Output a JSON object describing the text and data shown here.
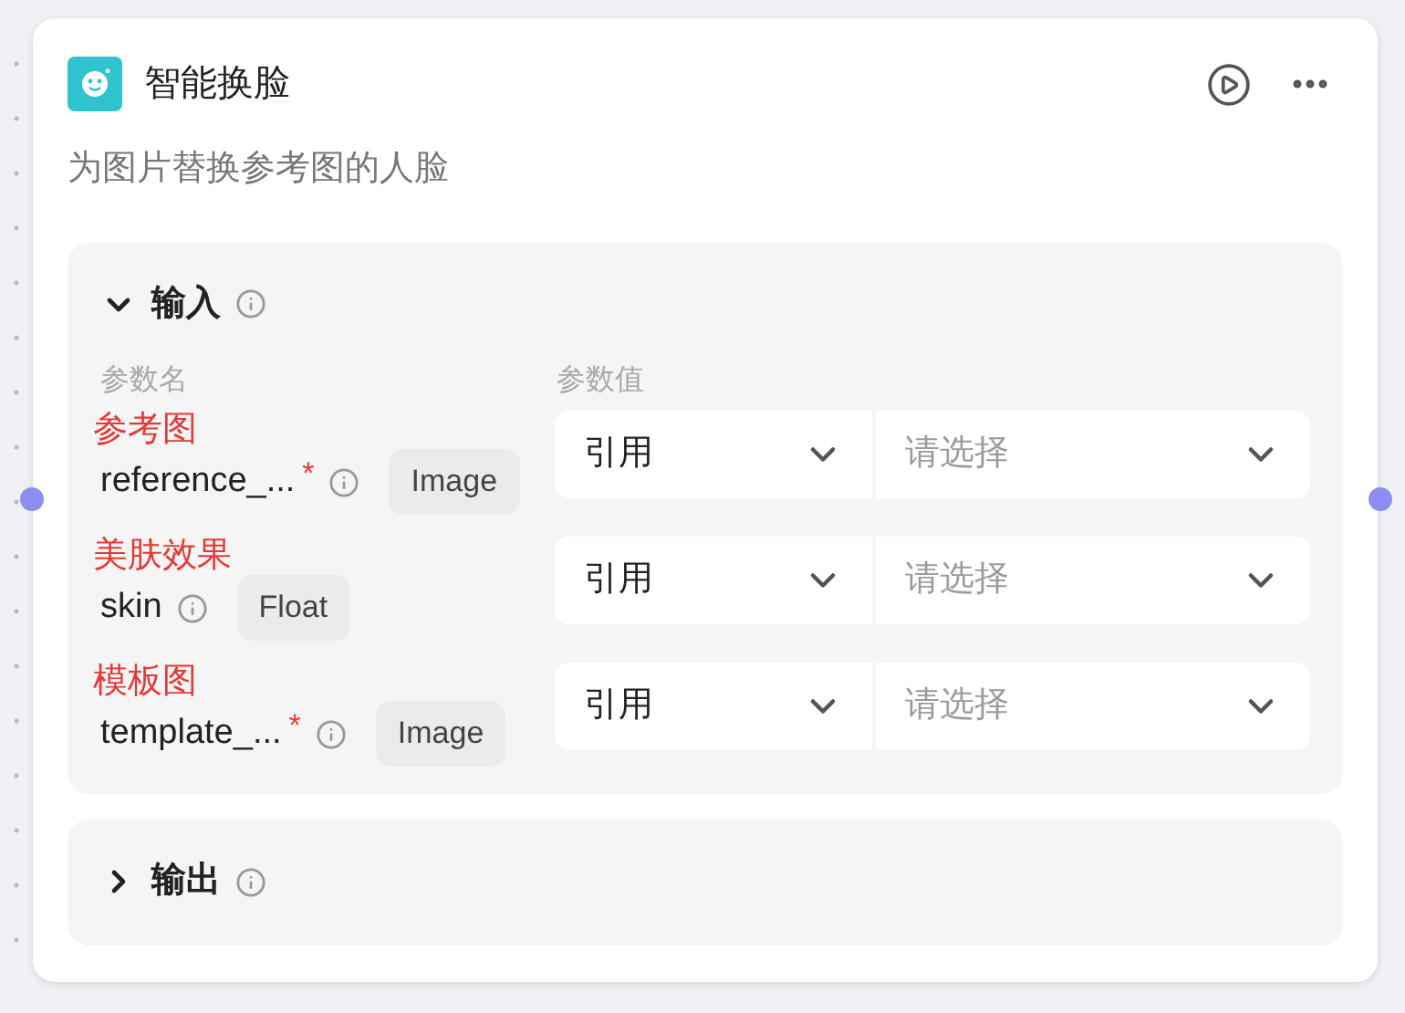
{
  "node": {
    "title": "智能换脸",
    "description": "为图片替换参考图的人脸"
  },
  "sections": [
    {
      "title": "输入",
      "expanded": true,
      "columns": [
        "参数名",
        "参数值"
      ],
      "params": [
        {
          "annotation": "参考图",
          "name": "reference_...",
          "required_mark": "*",
          "type": "Image",
          "source": "引用",
          "placeholder": "请选择"
        },
        {
          "annotation": "美肤效果",
          "name": "skin",
          "type": "Float",
          "source": "引用",
          "placeholder": "请选择"
        },
        {
          "annotation": "模板图",
          "name": "template_...",
          "required_mark": "*",
          "type": "Image",
          "source": "引用",
          "placeholder": "请选择"
        }
      ]
    },
    {
      "title": "输出",
      "expanded": false
    }
  ]
}
